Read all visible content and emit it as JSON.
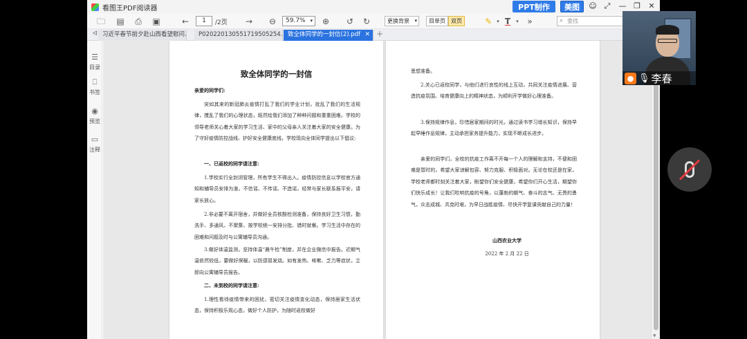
{
  "app": {
    "title": "看图王PDF阅读器",
    "ppt_button": "PPT制作",
    "meitu_button": "美图"
  },
  "toolbar": {
    "page_current": "1",
    "page_total": "/2页",
    "zoom": "59.7%",
    "bg_switch": "更换背景",
    "single_page": "目单页",
    "double_page": "双页",
    "search_placeholder": "查找"
  },
  "tabs": [
    {
      "label": "习近平春节前夕赴山西看望慰问..."
    },
    {
      "label": "P020220130551719505254..."
    },
    {
      "label": "致全体同学的一封信(2).pdf"
    }
  ],
  "sidebar": {
    "items": [
      {
        "label": "目录",
        "icon": "list-icon"
      },
      {
        "label": "书签",
        "icon": "bookmark-icon"
      },
      {
        "label": "预览",
        "icon": "eye-icon"
      },
      {
        "label": "注释",
        "icon": "comment-icon"
      }
    ]
  },
  "document": {
    "title": "致全体同学的一封信",
    "greeting": "亲爱的同学们:",
    "intro": "突如其来的新冠肺炎疫情打乱了我们的学业计划，扰乱了我们的生活规律，搅乱了我们的心理状态，既然给我们添加了种种问题和重重困难。学校的领导老师关心着大家的学习生活、家中的父母亲人关注着大家的安全健康。为了守好疫情防控战线、护好安全健康底线，学校现向全体同学提出以下倡议:",
    "section1": "一、已返校的同学请注意:",
    "s1p1": "1.学校实行全封闭管理，所有学生不得出入。疫情防控信息以学校官方通知和辅导员安排为准，不信谣、不传谣、不造谣，经常与家长联系报平安，请家长放心。",
    "s1p2": "2.非必要不离开宿舍，并做好全员核酸检测准备，保持良好卫生习惯，勤洗手、多通风、不聚集、按学校统一安排分批、错时就餐。学习生活中存在的困难和问题及时与公寓辅导员沟通。",
    "s1p3": "3.做好体温监测，坚持体温“晨午检”制度，并在企业微信中报告。近期气温依然较低，要做好保暖，以防感冒发烧。如有发热、咳嗽、乏力等症状，立即向公寓辅导员报告。",
    "section2": "二、未到校的同学请注意:",
    "s2p1": "1.理性看待疫情带来的困扰，密切关注疫情变化动态，保持居家生活状态，保持积极乐观心态，做好个人防护，为随时返校做好",
    "r_cont": "思想准备。",
    "s2p2": "2.关心已返校同学，与他们进行良性的线上互动，共同关注疫情进展、营造抗疫氛围、培育健康向上的精神状态，为顺利开学做好心理准备。",
    "s2p3": "3.保持规律作息，珍惜居家期间的时光，通过读书学习增长知识，保持早起早睡作息规律，主动承担家务提升能力，实现不断成长进步。",
    "closing": "亲爱的同学们，全校的抗疫工作离不开每一个人的理解和支持，不便和困难是暂时的，希望大家谅解包容、努力克服、积极面对。无论在校还是在家，学校老师都时刻关注着大家，盼望你们安全健康，希望你们开心生活，期望你们快乐成长！让我们吹响抗疫的号角，以蓬勃的朝气、奋斗的志气、无畏的勇气，众志成城、共克时艰，为早日战胜疫情、尽快开学复课贡献自己的力量！",
    "signature": "山西农业大学",
    "date": "2022 年 2 月 22 日"
  },
  "participant": {
    "name": "李春"
  }
}
